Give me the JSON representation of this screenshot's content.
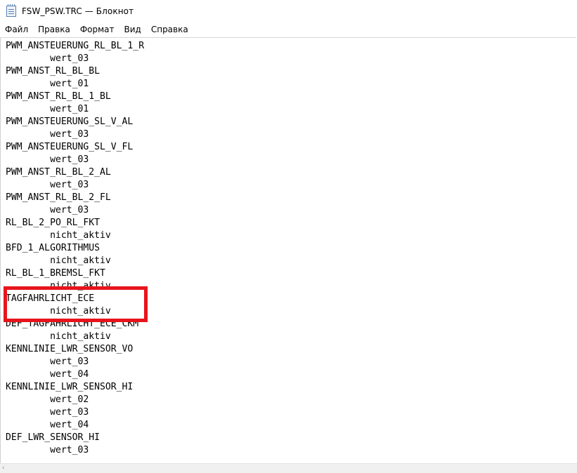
{
  "window": {
    "title": "FSW_PSW.TRC — Блокнот",
    "icon": "notepad-icon"
  },
  "menu": {
    "items": [
      "Файл",
      "Правка",
      "Формат",
      "Вид",
      "Справка"
    ]
  },
  "editor": {
    "lines": [
      "PWM_ANSTEUERUNG_RL_BL_1_R",
      "        wert_03",
      "PWM_ANST_RL_BL_BL",
      "        wert_01",
      "PWM_ANST_RL_BL_1_BL",
      "        wert_01",
      "PWM_ANSTEUERUNG_SL_V_AL",
      "        wert_03",
      "PWM_ANSTEUERUNG_SL_V_FL",
      "        wert_03",
      "PWM_ANST_RL_BL_2_AL",
      "        wert_03",
      "PWM_ANST_RL_BL_2_FL",
      "        wert_03",
      "RL_BL_2_PO_RL_FKT",
      "        nicht_aktiv",
      "BFD_1_ALGORITHMUS",
      "        nicht_aktiv",
      "RL_BL_1_BREMSL_FKT",
      "        nicht_aktiv",
      "TAGFAHRLICHT_ECE",
      "        nicht_aktiv",
      "DEF_TAGFAHRLICHT_ECE_CKM",
      "        nicht_aktiv",
      "KENNLINIE_LWR_SENSOR_VO",
      "        wert_03",
      "        wert_04",
      "KENNLINIE_LWR_SENSOR_HI",
      "        wert_02",
      "        wert_03",
      "        wert_04",
      "DEF_LWR_SENSOR_HI",
      "        wert_03"
    ],
    "highlight_color": "#e8141c"
  },
  "scrollbar": {
    "left_arrow": "‹"
  }
}
